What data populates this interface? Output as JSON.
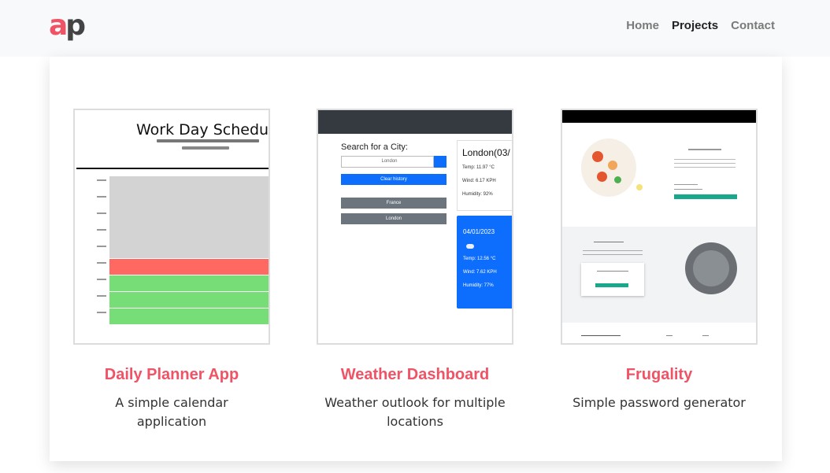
{
  "logo": {
    "first": "a",
    "second": "p"
  },
  "nav": [
    {
      "label": "Home",
      "active": false
    },
    {
      "label": "Projects",
      "active": true
    },
    {
      "label": "Contact",
      "active": false
    }
  ],
  "projects": [
    {
      "title": "Daily Planner App",
      "description": "A simple calendar application",
      "screenshot": {
        "heading": "Work Day Schedule"
      }
    },
    {
      "title": "Weather Dashboard",
      "description": "Weather outlook for multiple locations",
      "screenshot": {
        "search_label": "Search for a City:",
        "search_value": "London",
        "clear_label": "Clear history",
        "history": [
          "France",
          "London"
        ],
        "city": "London(03/",
        "today": [
          "Temp: 11.97 °C",
          "Wind: 6.17 KPH",
          "Humidity: 92%"
        ],
        "forecast_date": "04/01/2023",
        "forecast": [
          "Temp: 12.56 °C",
          "Wind: 7.62 KPH",
          "Humidity: 77%"
        ]
      }
    },
    {
      "title": "Frugality",
      "description": "Simple password generator",
      "screenshot": {}
    }
  ],
  "colors": {
    "accent": "#ef5366",
    "navbar_bg": "#f8f9fa",
    "planner_past": "#d3d3d3",
    "planner_present": "#ff6961",
    "planner_future": "#77dd77"
  }
}
